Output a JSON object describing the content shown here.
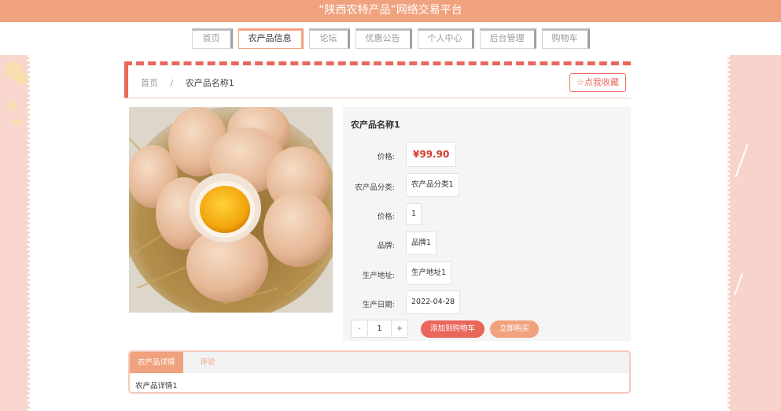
{
  "header": {
    "site_title": "“陕西农特产品”网络交易平台"
  },
  "nav": {
    "items": [
      {
        "label": "首页",
        "active": false
      },
      {
        "label": "农产品信息",
        "active": true
      },
      {
        "label": "论坛",
        "active": false
      },
      {
        "label": "优惠公告",
        "active": false
      },
      {
        "label": "个人中心",
        "active": false
      },
      {
        "label": "后台管理",
        "active": false
      },
      {
        "label": "购物车",
        "active": false
      }
    ]
  },
  "breadcrumb": {
    "home": "首页",
    "separator": "/",
    "current": "农产品名称1"
  },
  "favorite_button": {
    "icon": "star-outline-icon",
    "label": "点我收藏"
  },
  "product": {
    "name": "农产品名称1",
    "image_icon": "eggs-in-straw-basket-photo",
    "fields": [
      {
        "label": "价格:",
        "value": "¥99.90",
        "highlight": true
      },
      {
        "label": "农产品分类:",
        "value": "农产品分类1"
      },
      {
        "label": "价格:",
        "value": "1"
      },
      {
        "label": "品牌:",
        "value": "品牌1"
      },
      {
        "label": "生产地址:",
        "value": "生产地址1"
      },
      {
        "label": "生产日期:",
        "value": "2022-04-28"
      }
    ]
  },
  "quantity": {
    "minus": "-",
    "value": "1",
    "plus": "+"
  },
  "actions": {
    "add_to_cart": "添加到购物车",
    "buy_now": "立即购买"
  },
  "detail_tabs": {
    "tabs": [
      {
        "label": "农产品详情",
        "active": true
      },
      {
        "label": "评论",
        "active": false
      }
    ],
    "content": "农产品详情1"
  },
  "colors": {
    "brand": "#f0a27f",
    "accent_red": "#e9675a",
    "price_red": "#d23b2a",
    "side_pink": "#f8d6cd"
  }
}
